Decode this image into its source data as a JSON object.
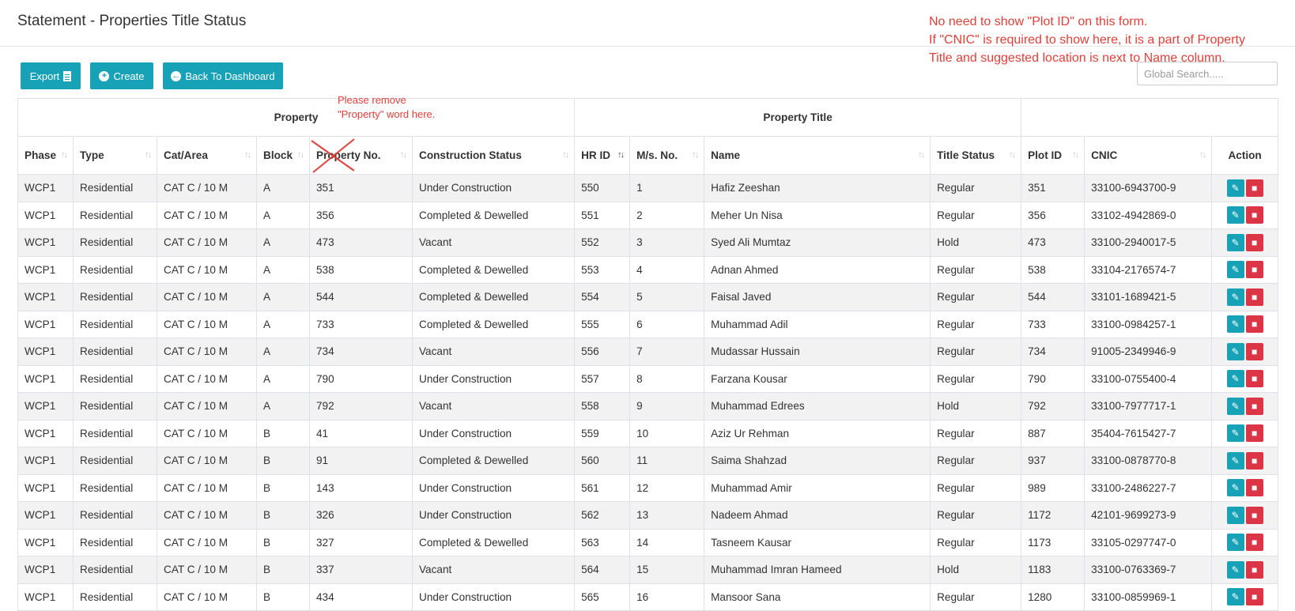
{
  "page": {
    "title": "Statement - Properties Title Status"
  },
  "annotation": {
    "lines": [
      "No need to show \"Plot ID\" on this form.",
      "If \"CNIC\" is required to show here, it is a part of Property",
      "Title and suggested location is next to Name column."
    ],
    "property_note": [
      "Please remove",
      "\"Property\" word here."
    ],
    "color": "#e0403a"
  },
  "toolbar": {
    "export_label": "Export",
    "create_label": "Create",
    "back_label": "Back To Dashboard",
    "accent": "#17a2b8"
  },
  "search": {
    "placeholder": "Global Search....."
  },
  "table": {
    "groups": [
      "Property",
      "Property Title",
      ""
    ],
    "columns": [
      "Phase",
      "Type",
      "Cat/Area",
      "Block",
      "Property No.",
      "Construction Status",
      "HR ID",
      "M/s. No.",
      "Name",
      "Title Status",
      "Plot ID",
      "CNIC",
      "Action"
    ],
    "rows": [
      [
        "WCP1",
        "Residential",
        "CAT C / 10 M",
        "A",
        "351",
        "Under Construction",
        "550",
        "1",
        "Hafiz Zeeshan",
        "Regular",
        "351",
        "33100-6943700-9"
      ],
      [
        "WCP1",
        "Residential",
        "CAT C / 10 M",
        "A",
        "356",
        "Completed & Dewelled",
        "551",
        "2",
        "Meher Un Nisa",
        "Regular",
        "356",
        "33102-4942869-0"
      ],
      [
        "WCP1",
        "Residential",
        "CAT C / 10 M",
        "A",
        "473",
        "Vacant",
        "552",
        "3",
        "Syed Ali Mumtaz",
        "Hold",
        "473",
        "33100-2940017-5"
      ],
      [
        "WCP1",
        "Residential",
        "CAT C / 10 M",
        "A",
        "538",
        "Completed & Dewelled",
        "553",
        "4",
        "Adnan Ahmed",
        "Regular",
        "538",
        "33104-2176574-7"
      ],
      [
        "WCP1",
        "Residential",
        "CAT C / 10 M",
        "A",
        "544",
        "Completed & Dewelled",
        "554",
        "5",
        "Faisal Javed",
        "Regular",
        "544",
        "33101-1689421-5"
      ],
      [
        "WCP1",
        "Residential",
        "CAT C / 10 M",
        "A",
        "733",
        "Completed & Dewelled",
        "555",
        "6",
        "Muhammad Adil",
        "Regular",
        "733",
        "33100-0984257-1"
      ],
      [
        "WCP1",
        "Residential",
        "CAT C / 10 M",
        "A",
        "734",
        "Vacant",
        "556",
        "7",
        "Mudassar Hussain",
        "Regular",
        "734",
        "91005-2349946-9"
      ],
      [
        "WCP1",
        "Residential",
        "CAT C / 10 M",
        "A",
        "790",
        "Under Construction",
        "557",
        "8",
        "Farzana Kousar",
        "Regular",
        "790",
        "33100-0755400-4"
      ],
      [
        "WCP1",
        "Residential",
        "CAT C / 10 M",
        "A",
        "792",
        "Vacant",
        "558",
        "9",
        "Muhammad Edrees",
        "Hold",
        "792",
        "33100-7977717-1"
      ],
      [
        "WCP1",
        "Residential",
        "CAT C / 10 M",
        "B",
        "41",
        "Under Construction",
        "559",
        "10",
        "Aziz Ur Rehman",
        "Regular",
        "887",
        "35404-7615427-7"
      ],
      [
        "WCP1",
        "Residential",
        "CAT C / 10 M",
        "B",
        "91",
        "Completed & Dewelled",
        "560",
        "11",
        "Saima Shahzad",
        "Regular",
        "937",
        "33100-0878770-8"
      ],
      [
        "WCP1",
        "Residential",
        "CAT C / 10 M",
        "B",
        "143",
        "Under Construction",
        "561",
        "12",
        "Muhammad Amir",
        "Regular",
        "989",
        "33100-2486227-7"
      ],
      [
        "WCP1",
        "Residential",
        "CAT C / 10 M",
        "B",
        "326",
        "Under Construction",
        "562",
        "13",
        "Nadeem Ahmad",
        "Regular",
        "1172",
        "42101-9699273-9"
      ],
      [
        "WCP1",
        "Residential",
        "CAT C / 10 M",
        "B",
        "327",
        "Completed & Dewelled",
        "563",
        "14",
        "Tasneem Kausar",
        "Regular",
        "1173",
        "33105-0297747-0"
      ],
      [
        "WCP1",
        "Residential",
        "CAT C / 10 M",
        "B",
        "337",
        "Vacant",
        "564",
        "15",
        "Muhammad Imran Hameed",
        "Hold",
        "1183",
        "33100-0763369-7"
      ],
      [
        "WCP1",
        "Residential",
        "CAT C / 10 M",
        "B",
        "434",
        "Under Construction",
        "565",
        "16",
        "Mansoor Sana",
        "Regular",
        "1280",
        "33100-0859969-1"
      ]
    ],
    "row_action_icons": [
      "edit-icon",
      "delete-icon"
    ],
    "colors": {
      "edit": "#17a2b8",
      "delete": "#dc3545"
    }
  }
}
